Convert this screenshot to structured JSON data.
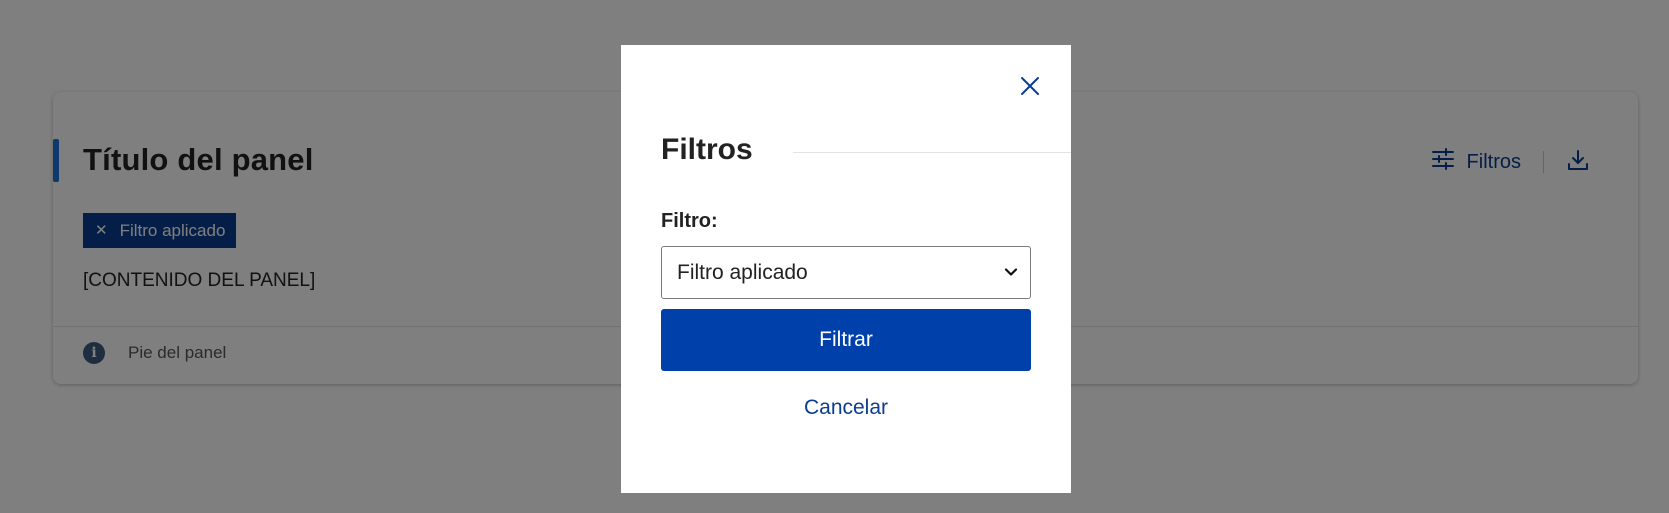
{
  "panel": {
    "title": "Título del panel",
    "actions": {
      "filters_label": "Filtros",
      "filters_icon": "sliders-icon",
      "download_icon": "download-icon"
    },
    "applied_filter_chip": {
      "label": "Filtro aplicado",
      "remove_icon": "close-icon"
    },
    "content": "[CONTENIDO DEL PANEL]",
    "footer": {
      "icon": "info-icon",
      "text": "Pie del panel"
    }
  },
  "modal": {
    "close_icon": "close-icon",
    "title": "Filtros",
    "field": {
      "label": "Filtro:",
      "selected_value": "Filtro aplicado"
    },
    "primary_button": "Filtrar",
    "cancel_link": "Cancelar"
  },
  "colors": {
    "primary": "#0040aa",
    "primary_dark": "#0b3d91",
    "accent": "#1a73d9",
    "overlay": "rgba(0,0,0,0.5)"
  }
}
